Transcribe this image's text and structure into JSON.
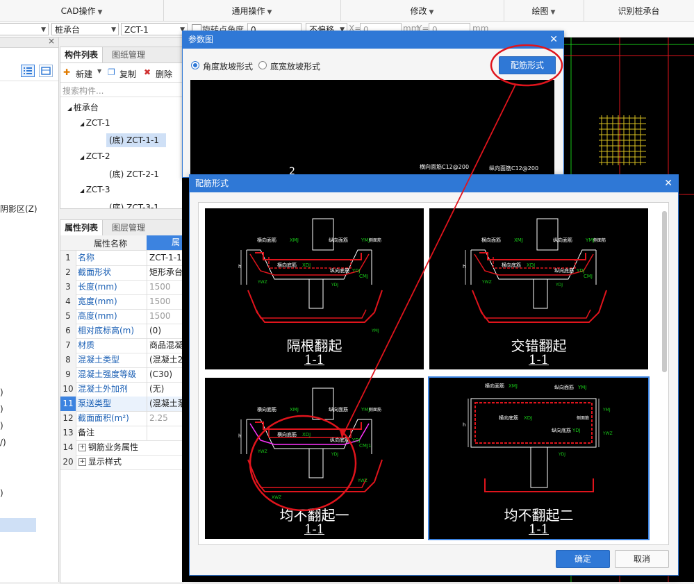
{
  "ribbon": {
    "groups": [
      {
        "label": "CAD操作"
      },
      {
        "label": "通用操作"
      },
      {
        "label": "修改"
      },
      {
        "label": "绘图"
      },
      {
        "label": "识别桩承台"
      }
    ]
  },
  "toolbar": {
    "left_combo": "",
    "type_combo": "桩承台",
    "name_combo": "ZCT-1",
    "rotate_checkbox_label": "旋转点角度",
    "angle_value": "0",
    "offset_combo": "不偏移",
    "x_label": "X=",
    "x_value": "0",
    "mm_x": "mm",
    "y_label": "Y=",
    "y_value": "0",
    "mm_y": "mm"
  },
  "left_panel": {
    "shadow_text": "阴影区(Z)",
    "frag1": ")",
    "frag2": ")",
    "frag3": ")",
    "frag4": "/)",
    "frag5": ")"
  },
  "component_list": {
    "tabs": [
      "构件列表",
      "图纸管理"
    ],
    "new_label": "新建",
    "copy_label": "复制",
    "delete_label": "删除",
    "search_placeholder": "搜索构件...",
    "tree": {
      "root": "桩承台",
      "items": [
        {
          "name": "ZCT-1",
          "child": "(底) ZCT-1-1"
        },
        {
          "name": "ZCT-2",
          "child": "(底) ZCT-2-1"
        },
        {
          "name": "ZCT-3",
          "child": "(底) ZCT-3-1"
        }
      ]
    }
  },
  "property_list": {
    "tabs": [
      "属性列表",
      "图层管理"
    ],
    "header_name": "属性名称",
    "header_value": "属",
    "rows": [
      {
        "num": "1",
        "name": "名称",
        "value": "ZCT-1-1"
      },
      {
        "num": "2",
        "name": "截面形状",
        "value": "矩形承台"
      },
      {
        "num": "3",
        "name": "长度(mm)",
        "value": "1500"
      },
      {
        "num": "4",
        "name": "宽度(mm)",
        "value": "1500"
      },
      {
        "num": "5",
        "name": "高度(mm)",
        "value": "1500"
      },
      {
        "num": "6",
        "name": "相对底标高(m)",
        "value": "(0)"
      },
      {
        "num": "7",
        "name": "材质",
        "value": "商品混凝"
      },
      {
        "num": "8",
        "name": "混凝土类型",
        "value": "(混凝土2"
      },
      {
        "num": "9",
        "name": "混凝土强度等级",
        "value": "(C30)"
      },
      {
        "num": "10",
        "name": "混凝土外加剂",
        "value": "(无)"
      },
      {
        "num": "11",
        "name": "泵送类型",
        "value": "(混凝土泵"
      },
      {
        "num": "12",
        "name": "截面面积(m²)",
        "value": "2.25"
      },
      {
        "num": "13",
        "name": "备注",
        "value": ""
      },
      {
        "num": "14",
        "name": "钢筋业务属性",
        "value": ""
      },
      {
        "num": "20",
        "name": "显示样式",
        "value": ""
      }
    ]
  },
  "dialog_params": {
    "title": "参数图",
    "radio_angle": "角度放坡形式",
    "radio_width": "底宽放坡形式",
    "rebar_button": "配筋形式",
    "preview_labels": {
      "h_top": "横向面筋C12@200",
      "v_top": "纵向面筋C12@200",
      "num": "2"
    }
  },
  "dialog_rebar": {
    "title": "配筋形式",
    "options": [
      {
        "caption": "隔根翻起",
        "section": "1-1"
      },
      {
        "caption": "交错翻起",
        "section": "1-1"
      },
      {
        "caption": "均不翻起一",
        "section": "1-1"
      },
      {
        "caption": "均不翻起二",
        "section": "1-1"
      }
    ],
    "labels": {
      "h_top": "横向面筋",
      "v_top": "纵向面筋",
      "h_bot": "横向底筋",
      "v_bot": "纵向底筋",
      "ymj": "YMJ",
      "xmj": "XMJ",
      "xdj": "XDJ",
      "ydj": "YDJ",
      "cmj": "CMJ",
      "cmj1": "CMJ1",
      "xwz": "XWZ",
      "ywz": "YWZ",
      "side": "侧面筋",
      "h": "h"
    },
    "ok": "确定",
    "cancel": "取消"
  },
  "colors": {
    "accent": "#2f78d6",
    "annotation": "#e0141c",
    "cad_green": "#19c819",
    "cad_magenta": "#ff33ff"
  }
}
